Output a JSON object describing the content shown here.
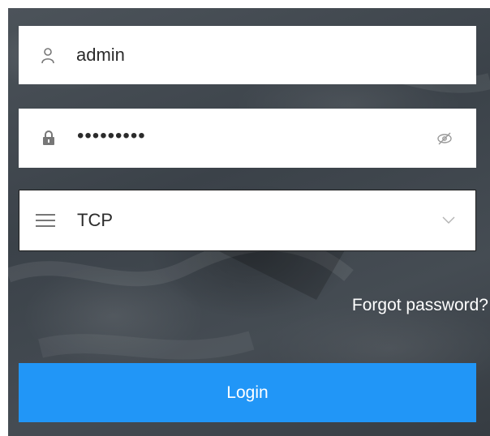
{
  "login_form": {
    "username": {
      "value": "admin",
      "icon": "user-icon"
    },
    "password": {
      "value": "•••••••••",
      "icon": "lock-icon",
      "toggle_icon": "eye-slash-icon"
    },
    "protocol": {
      "selected": "TCP",
      "icon": "menu-icon",
      "dropdown_icon": "chevron-down-icon"
    },
    "forgot_password": "Forgot password?",
    "login_button": "Login"
  },
  "colors": {
    "accent": "#2196f7",
    "background": "#42494f",
    "field_background": "#ffffff"
  }
}
